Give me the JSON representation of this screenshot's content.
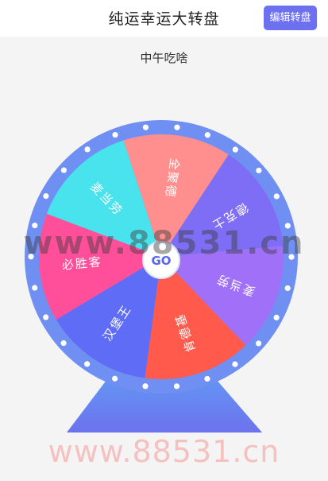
{
  "header": {
    "title": "纯运幸运大转盘",
    "edit_button": "编辑转盘"
  },
  "wheel": {
    "title": "中午吃啥",
    "go_label": "GO",
    "segments": [
      {
        "label": "全聚德",
        "color": "#ff8f8f"
      },
      {
        "label": "德克士",
        "color": "#7e6ef5"
      },
      {
        "label": "麦当劳",
        "color": "#a070f8"
      },
      {
        "label": "肯德基",
        "color": "#ff5a4c"
      },
      {
        "label": "汉堡王",
        "color": "#5f6cf6"
      },
      {
        "label": "必胜客",
        "color": "#ff4f9a"
      },
      {
        "label": "麦当劳",
        "color": "#49e3ee"
      }
    ],
    "rim_color": "#6f8ff2",
    "stand_color_top": "#5ea7f7",
    "stand_color_bottom": "#6d72ee"
  },
  "watermark": {
    "bottom_text": "www.88531.cn",
    "center_text": "www.88531.cn"
  }
}
